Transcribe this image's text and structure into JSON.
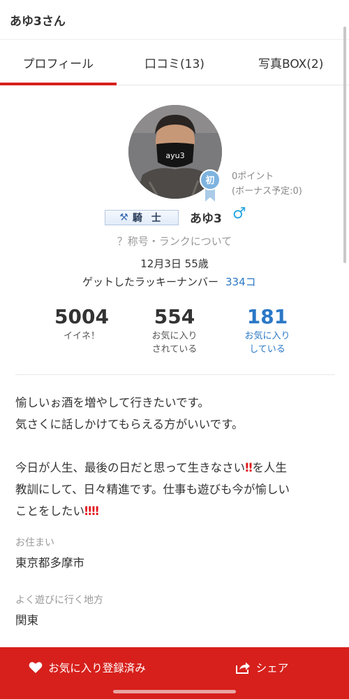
{
  "header": {
    "title": "あゆ3さん"
  },
  "tabs": [
    {
      "label": "プロフィール",
      "active": true
    },
    {
      "label": "口コミ(13)",
      "active": false
    },
    {
      "label": "写真BOX(2)",
      "active": false
    }
  ],
  "profile": {
    "avatar_text": "ayu3",
    "rank_badge": "初",
    "points": "0ポイント",
    "bonus": "(ボーナス予定:0)",
    "title_badge": "騎 士",
    "title_icon": "⚒",
    "username": "あゆ3",
    "gender_symbol": "♂",
    "rank_link": "？称号・ランクについて",
    "birthday": "12月3日 55歳",
    "lucky_label": "ゲットしたラッキーナンバー",
    "lucky_value": "334コ"
  },
  "stats": [
    {
      "num": "5004",
      "line1": "イイネ！",
      "line2": ""
    },
    {
      "num": "554",
      "line1": "お気に入り",
      "line2": "されている"
    },
    {
      "num": "181",
      "line1": "お気に入り",
      "line2": "している"
    }
  ],
  "bio": {
    "line1": "愉しいぉ酒を増やして行きたいです。",
    "line2": "気さくに話しかけてもらえる方がいいです。",
    "line3a": "今日が人生、最後の日だと思って生きなさい",
    "line3b": "を人生",
    "line4": "教訓にして、日々精進です。仕事も遊びも今が愉しい",
    "line5": "ことをしたい",
    "exclaim": "‼"
  },
  "info": {
    "residence_label": "お住まい",
    "residence_value": "東京都多摩市",
    "area_label": "よく遊びに行く地方",
    "area_value": "関東"
  },
  "bottom_bar": {
    "favorite_label": "お気に入り登録済み",
    "share_label": "シェア"
  },
  "colors": {
    "accent": "#d7201c",
    "link": "#2b78c6",
    "male": "#2aa7e0"
  }
}
